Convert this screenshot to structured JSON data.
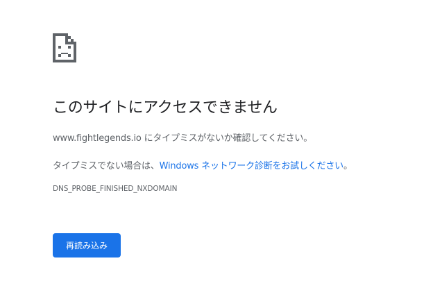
{
  "icon": "sad-page-icon",
  "title": "このサイトにアクセスできません",
  "message": {
    "domain": "www.fightlegends.io",
    "suffix": " にタイプミスがないか確認してください。"
  },
  "suggestion": {
    "prefix": "タイプミスでない場合は、",
    "link_text": "Windows ネットワーク診断をお試しください",
    "suffix": "。"
  },
  "error_code": "DNS_PROBE_FINISHED_NXDOMAIN",
  "reload_button_label": "再読み込み",
  "colors": {
    "accent": "#1a73e8",
    "text_primary": "#202124",
    "text_secondary": "#5f6368"
  }
}
